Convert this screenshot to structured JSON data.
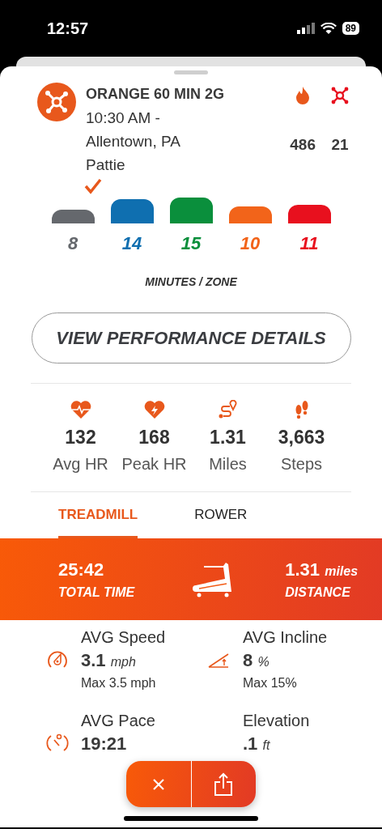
{
  "status_bar": {
    "time": "12:57",
    "battery": "89"
  },
  "class": {
    "title": "ORANGE 60 MIN 2G",
    "time": "10:30 AM -",
    "location": "Allentown, PA",
    "coach": "Pattie",
    "calories": "486",
    "splat_points": "21"
  },
  "zones": [
    {
      "minutes": "8",
      "color": "#65686d"
    },
    {
      "minutes": "14",
      "color": "#0f6fb0"
    },
    {
      "minutes": "15",
      "color": "#0a8f3c"
    },
    {
      "minutes": "10",
      "color": "#f2641a"
    },
    {
      "minutes": "11",
      "color": "#e8101e"
    }
  ],
  "zones_caption": "MINUTES / ZONE",
  "details_button": "VIEW PERFORMANCE DETAILS",
  "summary": [
    {
      "kind": "avg_hr",
      "value": "132",
      "label": "Avg HR"
    },
    {
      "kind": "peak_hr",
      "value": "168",
      "label": "Peak HR"
    },
    {
      "kind": "miles",
      "value": "1.31",
      "label": "Miles"
    },
    {
      "kind": "steps",
      "value": "3,663",
      "label": "Steps"
    }
  ],
  "tabs": [
    {
      "label": "TREADMILL",
      "selected": true
    },
    {
      "label": "ROWER",
      "selected": false
    }
  ],
  "banner": {
    "time": "25:42",
    "time_label": "TOTAL TIME",
    "distance": "1.31",
    "distance_unit": "miles",
    "distance_label": "DISTANCE"
  },
  "metrics": [
    {
      "kind": "speed",
      "title": "AVG Speed",
      "value": "3.1",
      "unit": "mph",
      "max": "Max 3.5 mph"
    },
    {
      "kind": "incline",
      "title": "AVG Incline",
      "value": "8",
      "unit": "%",
      "max": "Max 15%"
    },
    {
      "kind": "pace",
      "title": "AVG Pace",
      "value": "19:21"
    },
    {
      "kind": "elevation",
      "title": "Elevation",
      "value": ".1",
      "unit": "ft"
    }
  ]
}
